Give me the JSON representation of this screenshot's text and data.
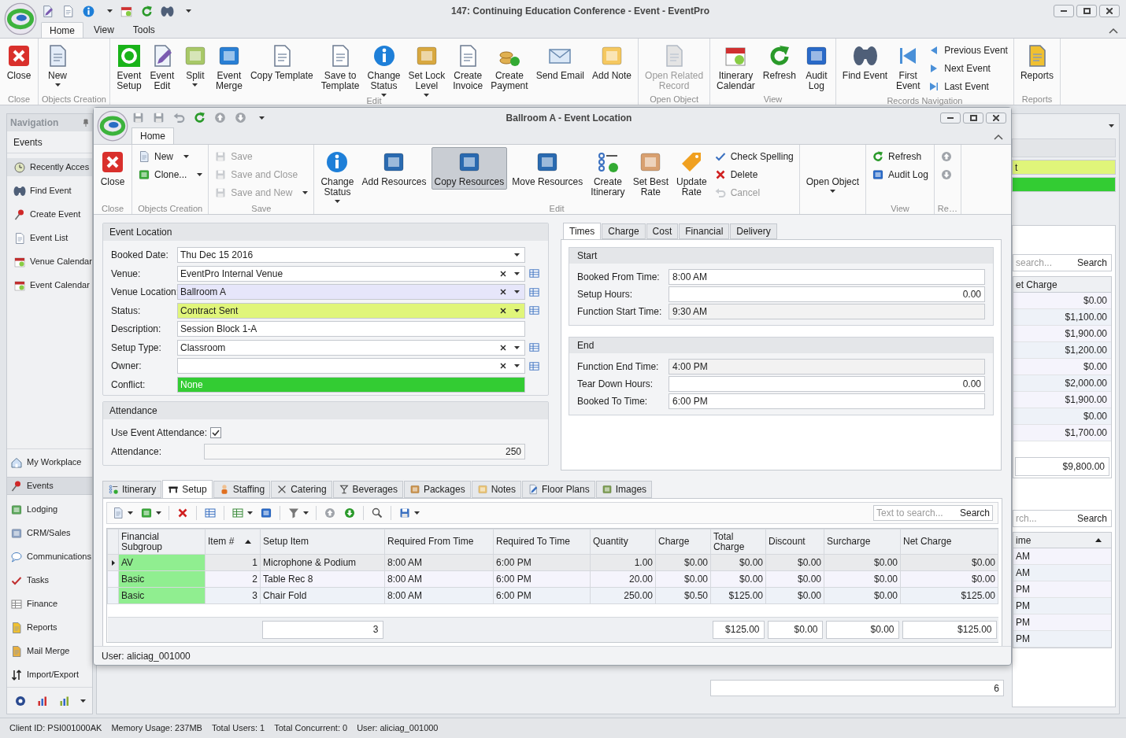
{
  "window": {
    "title": "147: Continuing Education Conference - Event - EventPro"
  },
  "ribbon_tabs": [
    {
      "label": "Home",
      "selected": true
    },
    {
      "label": "View",
      "selected": false
    },
    {
      "label": "Tools",
      "selected": false
    }
  ],
  "ribbon_groups": [
    {
      "label": "Close",
      "items": [
        {
          "kind": "large",
          "label": "Close"
        }
      ]
    },
    {
      "label": "Objects Creation",
      "items": [
        {
          "kind": "large",
          "label": "New",
          "dropdown": true
        }
      ]
    },
    {
      "label": "Edit",
      "items": [
        {
          "kind": "large",
          "label": "Event\nSetup"
        },
        {
          "kind": "large",
          "label": "Event\nEdit"
        },
        {
          "kind": "large",
          "label": "Split",
          "dropdown": true
        },
        {
          "kind": "large",
          "label": "Event\nMerge"
        },
        {
          "kind": "large",
          "label": "Copy Template"
        },
        {
          "kind": "large",
          "label": "Save to\nTemplate"
        },
        {
          "kind": "large",
          "label": "Change\nStatus",
          "dropdown": true
        },
        {
          "kind": "large",
          "label": "Set Lock\nLevel",
          "dropdown": true
        },
        {
          "kind": "large",
          "label": "Create\nInvoice"
        },
        {
          "kind": "large",
          "label": "Create\nPayment"
        },
        {
          "kind": "large",
          "label": "Send Email"
        },
        {
          "kind": "large",
          "label": "Add Note"
        }
      ]
    },
    {
      "label": "Open Object",
      "items": [
        {
          "kind": "large",
          "label": "Open Related\nRecord",
          "disabled": true
        }
      ]
    },
    {
      "label": "View",
      "items": [
        {
          "kind": "large",
          "label": "Itinerary\nCalendar"
        },
        {
          "kind": "large",
          "label": "Refresh"
        },
        {
          "kind": "large",
          "label": "Audit\nLog"
        }
      ]
    },
    {
      "label": "Records Navigation",
      "items": [
        {
          "kind": "large",
          "label": "Find Event"
        },
        {
          "kind": "large",
          "label": "First\nEvent"
        },
        {
          "kind": "small",
          "label": "Previous Event"
        },
        {
          "kind": "small",
          "label": "Next Event"
        },
        {
          "kind": "small",
          "label": "Last Event"
        }
      ]
    },
    {
      "label": "Reports",
      "items": [
        {
          "kind": "large",
          "label": "Reports"
        }
      ]
    }
  ],
  "navigation": {
    "title": "Navigation",
    "section_title": "Events",
    "shortcuts": [
      {
        "label": "Recently Acces",
        "selected": true
      },
      {
        "label": "Find Event",
        "selected": false
      },
      {
        "label": "Create Event",
        "selected": false
      },
      {
        "label": "Event List",
        "selected": false
      },
      {
        "label": "Venue Calendar",
        "selected": false
      },
      {
        "label": "Event Calendar",
        "selected": false
      }
    ],
    "modules": [
      {
        "label": "My Workplace",
        "selected": false
      },
      {
        "label": "Events",
        "selected": true
      },
      {
        "label": "Lodging",
        "selected": false
      },
      {
        "label": "CRM/Sales",
        "selected": false
      },
      {
        "label": "Communications",
        "selected": false
      },
      {
        "label": "Tasks",
        "selected": false
      },
      {
        "label": "Finance",
        "selected": false
      },
      {
        "label": "Reports",
        "selected": false
      },
      {
        "label": "Mail Merge",
        "selected": false
      },
      {
        "label": "Import/Export",
        "selected": false
      }
    ]
  },
  "background_panel": {
    "fields": [
      {
        "value": "t",
        "color": "#e0f57a"
      },
      {
        "color": "#33cc33"
      }
    ],
    "grid_1": {
      "search_placeholder": "search...",
      "search_button": "Search",
      "column": "et Charge",
      "values": [
        "$0.00",
        "$1,100.00",
        "$1,900.00",
        "$1,200.00",
        "$0.00",
        "$2,000.00",
        "$1,900.00",
        "$0.00",
        "$1,700.00"
      ],
      "total": "$9,800.00"
    },
    "grid_2": {
      "search_placeholder": "rch...",
      "search_button": "Search",
      "column": "ime",
      "sort_ascending": true,
      "values": [
        "AM",
        "AM",
        "PM",
        "PM",
        "PM",
        "PM"
      ],
      "footer_count": "6"
    }
  },
  "dialog": {
    "title": "Ballroom A - Event Location",
    "ribbon_tabs": [
      {
        "label": "Home",
        "selected": true
      }
    ],
    "ribbon_groups": [
      {
        "label": "Close",
        "items": [
          {
            "kind": "large",
            "label": "Close"
          }
        ]
      },
      {
        "label": "Objects Creation",
        "items": [
          {
            "kind": "small",
            "label": "New",
            "dropdown": true
          },
          {
            "kind": "small",
            "label": "Clone...",
            "dropdown": true
          }
        ]
      },
      {
        "label": "Save",
        "items": [
          {
            "kind": "small",
            "label": "Save",
            "disabled": true
          },
          {
            "kind": "small",
            "label": "Save and Close",
            "disabled": true
          },
          {
            "kind": "small",
            "label": "Save and New",
            "disabled": true,
            "dropdown": true
          }
        ]
      },
      {
        "label": "Edit",
        "items": [
          {
            "kind": "large",
            "label": "Change\nStatus",
            "dropdown": true
          },
          {
            "kind": "large",
            "label": "Add Resources"
          },
          {
            "kind": "large",
            "label": "Copy Resources",
            "pressed": true
          },
          {
            "kind": "large",
            "label": "Move Resources"
          },
          {
            "kind": "large",
            "label": "Create\nItinerary"
          },
          {
            "kind": "large",
            "label": "Set Best\nRate"
          },
          {
            "kind": "large",
            "label": "Update\nRate"
          },
          {
            "kind": "small",
            "label": "Check Spelling"
          },
          {
            "kind": "small",
            "label": "Delete"
          },
          {
            "kind": "small",
            "label": "Cancel",
            "disabled": true
          }
        ]
      },
      {
        "items": [
          {
            "kind": "large",
            "label": "Open Object",
            "dropdown": true
          }
        ]
      },
      {
        "label": "View",
        "items": [
          {
            "kind": "small",
            "label": "Refresh"
          },
          {
            "kind": "small",
            "label": "Audit Log"
          }
        ]
      },
      {
        "label": "Re…",
        "items": [
          {
            "kind": "small"
          },
          {
            "kind": "small"
          }
        ]
      }
    ],
    "event_location": {
      "title": "Event Location",
      "fields": [
        {
          "label": "Booked Date:",
          "kind": "date",
          "value": "Thu Dec 15 2016"
        },
        {
          "label": "Venue:",
          "kind": "lookup",
          "value": "EventPro Internal Venue"
        },
        {
          "label": "Venue Location:",
          "kind": "lookup",
          "value": "Ballroom A",
          "color": "#e6e6fa"
        },
        {
          "label": "Status:",
          "kind": "lookup",
          "value": "Contract Sent",
          "color": "#e0f57a"
        },
        {
          "label": "Description:",
          "kind": "text",
          "value": "Session Block 1-A"
        },
        {
          "label": "Setup Type:",
          "kind": "lookup",
          "value": "Classroom"
        },
        {
          "label": "Owner:",
          "kind": "lookup"
        },
        {
          "label": "Conflict:",
          "kind": "indicator",
          "value": "None",
          "color": "#33cc33"
        }
      ]
    },
    "attendance": {
      "title": "Attendance",
      "use_event_attendance": {
        "label": "Use Event Attendance:",
        "checked": true
      },
      "attendance": {
        "label": "Attendance:",
        "value": "250"
      }
    },
    "detail_tabs": [
      {
        "label": "Times",
        "selected": true
      },
      {
        "label": "Charge",
        "selected": false
      },
      {
        "label": "Cost",
        "selected": false
      },
      {
        "label": "Financial",
        "selected": false
      },
      {
        "label": "Delivery",
        "selected": false
      }
    ],
    "times": [
      {
        "title": "Start",
        "fields": [
          {
            "label": "Booked From Time:",
            "kind": "text",
            "value": "8:00 AM"
          },
          {
            "label": "Setup Hours:",
            "kind": "number",
            "value": "0.00"
          },
          {
            "label": "Function Start Time:",
            "kind": "text",
            "value": "9:30 AM",
            "readonly": true
          }
        ]
      },
      {
        "title": "End",
        "fields": [
          {
            "label": "Function End Time:",
            "kind": "text",
            "value": "4:00 PM",
            "readonly": true
          },
          {
            "label": "Tear Down Hours:",
            "kind": "number",
            "value": "0.00"
          },
          {
            "label": "Booked To Time:",
            "kind": "text",
            "value": "6:00 PM"
          }
        ]
      }
    ],
    "section_tabs": [
      {
        "label": "Itinerary",
        "selected": false
      },
      {
        "label": "Setup",
        "selected": true
      },
      {
        "label": "Staffing",
        "selected": false
      },
      {
        "label": "Catering",
        "selected": false
      },
      {
        "label": "Beverages",
        "selected": false
      },
      {
        "label": "Packages",
        "selected": false
      },
      {
        "label": "Notes",
        "selected": false
      },
      {
        "label": "Floor Plans",
        "selected": false
      },
      {
        "label": "Images",
        "selected": false
      }
    ],
    "grid": {
      "search_placeholder": "Text to search...",
      "search_button": "Search",
      "columns": [
        {
          "label": "Financial Subgroup"
        },
        {
          "label": "Item #",
          "sort_ascending": true
        },
        {
          "label": "Setup Item"
        },
        {
          "label": "Required From Time"
        },
        {
          "label": "Required To Time"
        },
        {
          "label": "Quantity"
        },
        {
          "label": "Charge"
        },
        {
          "label": "Total\nCharge"
        },
        {
          "label": "Discount"
        },
        {
          "label": "Surcharge"
        },
        {
          "label": "Net Charge"
        }
      ],
      "rows": [
        {
          "selected": true,
          "color": "#90ee90",
          "cells": [
            "AV",
            "1",
            "Microphone & Podium",
            "8:00 AM",
            "6:00 PM",
            "1.00",
            "$0.00",
            "$0.00",
            "$0.00",
            "$0.00",
            "$0.00"
          ]
        },
        {
          "selected": false,
          "color": "#90ee90",
          "cells": [
            "Basic",
            "2",
            "Table Rec 8",
            "8:00 AM",
            "6:00 PM",
            "20.00",
            "$0.00",
            "$0.00",
            "$0.00",
            "$0.00",
            "$0.00"
          ]
        },
        {
          "selected": false,
          "color": "#90ee90",
          "cells": [
            "Basic",
            "3",
            "Chair Fold",
            "8:00 AM",
            "6:00 PM",
            "250.00",
            "$0.50",
            "$125.00",
            "$0.00",
            "$0.00",
            "$125.00"
          ]
        }
      ],
      "summary": {
        "count": "3",
        "totals": [
          "$125.00",
          "$0.00",
          "$0.00",
          "$125.00"
        ]
      }
    },
    "status": "User: aliciag_001000"
  },
  "status_bar": [
    "Client ID: PSI001000AK",
    "Memory Usage: 237MB",
    "Total Users: 1",
    "Total Concurrent: 0",
    "User: aliciag_001000"
  ]
}
